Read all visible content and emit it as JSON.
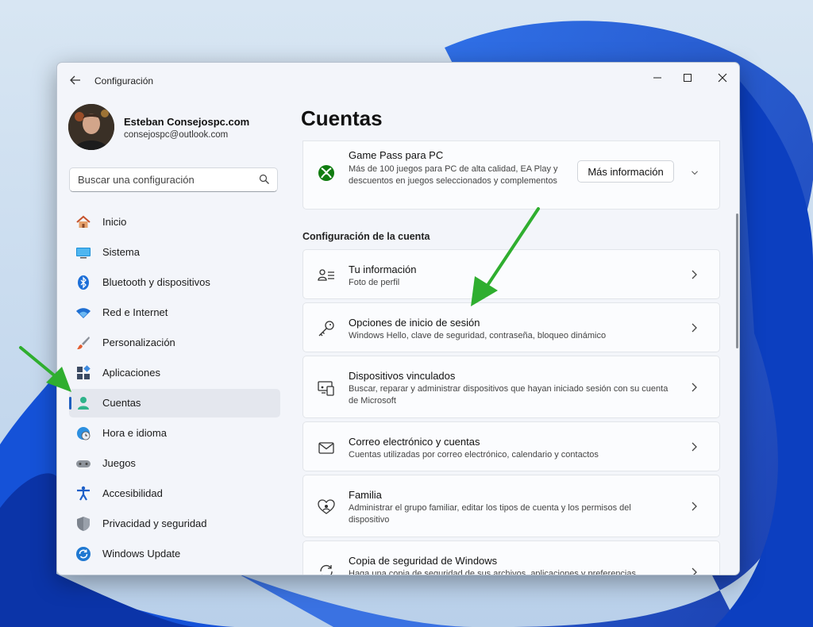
{
  "window": {
    "title": "Configuración"
  },
  "profile": {
    "name": "Esteban Consejospc.com",
    "email": "consejospc@outlook.com"
  },
  "search": {
    "placeholder": "Buscar una configuración"
  },
  "nav": {
    "items": [
      {
        "label": "Inicio",
        "icon": "home-icon"
      },
      {
        "label": "Sistema",
        "icon": "system-icon"
      },
      {
        "label": "Bluetooth y dispositivos",
        "icon": "bluetooth-icon"
      },
      {
        "label": "Red e Internet",
        "icon": "wifi-icon"
      },
      {
        "label": "Personalización",
        "icon": "brush-icon"
      },
      {
        "label": "Aplicaciones",
        "icon": "apps-icon"
      },
      {
        "label": "Cuentas",
        "icon": "person-icon",
        "active": true
      },
      {
        "label": "Hora e idioma",
        "icon": "globe-clock-icon"
      },
      {
        "label": "Juegos",
        "icon": "gamepad-icon"
      },
      {
        "label": "Accesibilidad",
        "icon": "accessibility-icon"
      },
      {
        "label": "Privacidad y seguridad",
        "icon": "shield-icon"
      },
      {
        "label": "Windows Update",
        "icon": "update-icon"
      }
    ]
  },
  "main": {
    "title": "Cuentas",
    "gamepass": {
      "title": "Game Pass para PC",
      "description": "Más de 100 juegos para PC de alta calidad, EA Play y descuentos en juegos seleccionados y complementos",
      "button": "Más información"
    },
    "section_title": "Configuración de la cuenta",
    "cards": [
      {
        "title": "Tu información",
        "subtitle": "Foto de perfil",
        "icon": "contact-card-icon"
      },
      {
        "title": "Opciones de inicio de sesión",
        "subtitle": "Windows Hello, clave de seguridad, contraseña, bloqueo dinámico",
        "icon": "key-icon"
      },
      {
        "title": "Dispositivos vinculados",
        "subtitle": "Buscar, reparar y administrar dispositivos que hayan iniciado sesión con su cuenta de Microsoft",
        "icon": "linked-devices-icon"
      },
      {
        "title": "Correo electrónico y cuentas",
        "subtitle": "Cuentas utilizadas por correo electrónico, calendario y contactos",
        "icon": "mail-icon"
      },
      {
        "title": "Familia",
        "subtitle": "Administrar el grupo familiar, editar los tipos de cuenta y los permisos del dispositivo",
        "icon": "family-heart-icon"
      },
      {
        "title": "Copia de seguridad de Windows",
        "subtitle": "Haga una copia de seguridad de sus archivos, aplicaciones y preferencias",
        "icon": "backup-icon"
      }
    ]
  },
  "colors": {
    "accent": "#1f5fbf",
    "annotation_arrow": "#2fae2f"
  }
}
